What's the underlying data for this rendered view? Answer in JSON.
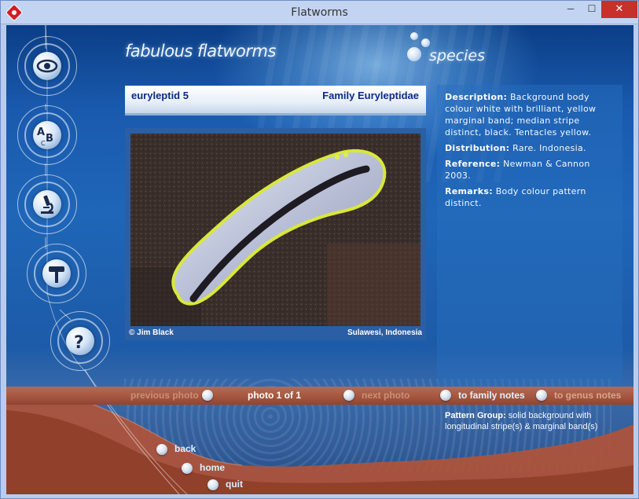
{
  "window": {
    "title": "Flatworms",
    "min_label": "─",
    "max_label": "☐",
    "close_label": "✕"
  },
  "header": {
    "brand": "fabulous flatworms",
    "section": "species"
  },
  "sidebar": {
    "items": [
      {
        "name": "eye",
        "icon": "eye-icon"
      },
      {
        "name": "alphabet",
        "icon": "abc-icon"
      },
      {
        "name": "microscope",
        "icon": "microscope-icon"
      },
      {
        "name": "tools",
        "icon": "hammer-icon"
      },
      {
        "name": "help",
        "icon": "question-icon"
      }
    ]
  },
  "species": {
    "name": "euryleptid 5",
    "family": "Family Euryleptidae",
    "photo_credit": "© Jim Black",
    "photo_location": "Sulawesi, Indonesia"
  },
  "info": {
    "description_label": "Description:",
    "description": "Background body colour white with brilliant, yellow marginal band; median stripe distinct, black. Tentacles yellow.",
    "distribution_label": "Distribution:",
    "distribution": "Rare. Indonesia.",
    "reference_label": "Reference:",
    "reference": "Newman & Cannon 2003.",
    "remarks_label": "Remarks:",
    "remarks": "Body colour pattern distinct."
  },
  "photo_nav": {
    "previous": "previous photo",
    "counter": "photo 1 of 1",
    "next": "next photo",
    "family_notes": "to family notes",
    "genus_notes": "to genus notes"
  },
  "pattern_group": {
    "label": "Pattern Group:",
    "text": "solid background with longitudinal stripe(s) & marginal band(s)"
  },
  "bottom_nav": {
    "back": "back",
    "home": "home",
    "quit": "quit"
  },
  "colors": {
    "accent_text": "#0a2a8a",
    "nav_bar": "#a55740",
    "background": "#1f66b8"
  }
}
